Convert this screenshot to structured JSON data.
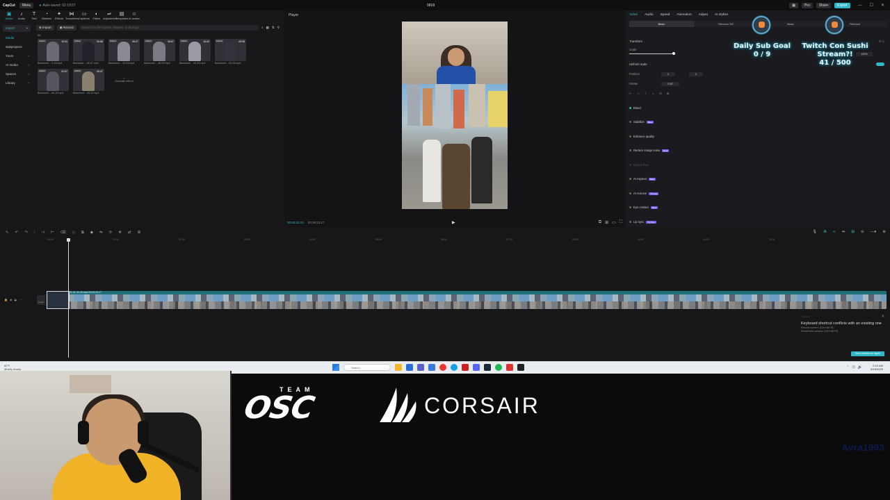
{
  "titlebar": {
    "app": "CapCut",
    "menu": "Menu",
    "autosave": "Auto saved: 02:19:57",
    "project": "0818",
    "pro": "Pro",
    "share": "Share",
    "export": "Export"
  },
  "toolbar": {
    "items": [
      {
        "icon": "media-icon",
        "label": "Media"
      },
      {
        "icon": "audio-icon",
        "label": "Audio"
      },
      {
        "icon": "text-icon",
        "label": "Text"
      },
      {
        "icon": "stickers-icon",
        "label": "Stickers"
      },
      {
        "icon": "effects-icon",
        "label": "Effects"
      },
      {
        "icon": "transitions-icon",
        "label": "Transitions"
      },
      {
        "icon": "captions-icon",
        "label": "Captions"
      },
      {
        "icon": "filters-icon",
        "label": "Filters"
      },
      {
        "icon": "adjustment-icon",
        "label": "Adjustment"
      },
      {
        "icon": "templates-icon",
        "label": "Templates"
      },
      {
        "icon": "ai-avatar-icon",
        "label": "AI avatar"
      }
    ]
  },
  "sidebar": {
    "import": "Import",
    "items": [
      "Media",
      "Subprojects",
      "Yours",
      "AI media",
      "Spaces",
      "Library"
    ]
  },
  "media": {
    "import_btn": "Import",
    "record_btn": "Record",
    "search_placeholder": "Search for file names, shapes, or dialogs",
    "filter_label": "All",
    "clips": [
      {
        "badge": "Added",
        "duration": "10:00",
        "name": "Basement ...0-43.mp4"
      },
      {
        "badge": "Added",
        "duration": "00:58",
        "name": "Backpack ...06-57.mp4"
      },
      {
        "badge": "Added",
        "duration": "09:27",
        "name": "Backroom ...13-43.mp4"
      },
      {
        "badge": "Added",
        "duration": "09:57",
        "name": "Backroom ...46-29.mp4"
      },
      {
        "badge": "Added",
        "duration": "10:00",
        "name": "Backroom ...49-31.mp4"
      },
      {
        "badge": "Added",
        "duration": "05:08",
        "name": "Backroom ...03-05.mp4"
      },
      {
        "badge": "Added",
        "duration": "02:57",
        "name": "Backroom ...46-19.mp4"
      },
      {
        "badge": "Added",
        "duration": "09:47",
        "name": "Basement ...45-12.mp4"
      }
    ],
    "generate_label": "Generate with AI"
  },
  "player": {
    "title": "Player",
    "time_current": "00:00:10:10",
    "time_total": "00:09:23:17"
  },
  "props": {
    "tabs": [
      "Video",
      "Audio",
      "Speed",
      "Animation",
      "Adjust",
      "AI stylize"
    ],
    "subtabs": [
      "Basic",
      "Remove BG",
      "Mask",
      "Retouch"
    ],
    "transform": "Transform",
    "scale": "Scale",
    "scale_value": "100%",
    "uniform_scale": "Uniform scale",
    "position": "Position",
    "pos_x": "0",
    "pos_y": "0",
    "rotate": "Rotate",
    "rotate_value": "0.00°",
    "features": [
      {
        "label": "Blend",
        "tag": "",
        "dim": false
      },
      {
        "label": "Stabilize",
        "tag": "Beta",
        "dim": false
      },
      {
        "label": "Enhance quality",
        "tag": "",
        "dim": false
      },
      {
        "label": "Reduce image noise",
        "tag": "Beta",
        "dim": false
      },
      {
        "label": "Optical flow",
        "tag": "",
        "dim": true
      },
      {
        "label": "AI expand",
        "tag": "Beta",
        "dim": false
      },
      {
        "label": "AI remove",
        "tag": "Try free",
        "dim": false
      },
      {
        "label": "Eye contact",
        "tag": "Beta",
        "dim": false
      },
      {
        "label": "Lip sync",
        "tag": "Try free",
        "dim": false
      }
    ]
  },
  "overlay": {
    "sub_goal_title": "Daily Sub Goal",
    "sub_goal_value": "0 / 9",
    "stream_title_1": "Twitch Con Sushi",
    "stream_title_2": "Stream?!",
    "stream_value": "41 / 500"
  },
  "timeline": {
    "ruler": [
      "00:00",
      "01:00",
      "02:00",
      "03:00",
      "04:00",
      "05:00",
      "06:00",
      "07:00",
      "08:00",
      "09:00",
      "10:00",
      "11:00"
    ],
    "clip_label": "Backpack 2025-08-11 01-43-49.mp4   00:09:23:17",
    "cover_label": "Cover"
  },
  "toast": {
    "caption": "Capcut",
    "message": "Keyboard shortcut conflicts with an existing one",
    "detail1": "Record screen: [Ctrl+Alt+R]",
    "detail2": "Show/hide camera: [Ctrl+Alt+R]",
    "button": "Don't remind me again"
  },
  "taskbar": {
    "weather_temp": "82°F",
    "weather_desc": "Mostly cloudy",
    "search": "Search",
    "time": "2:19 AM",
    "date": "8/18/2025"
  },
  "stream": {
    "team": "TEAM",
    "osc": "OSC",
    "corsair": "CORSAIR",
    "watermark": "Avra1993"
  }
}
